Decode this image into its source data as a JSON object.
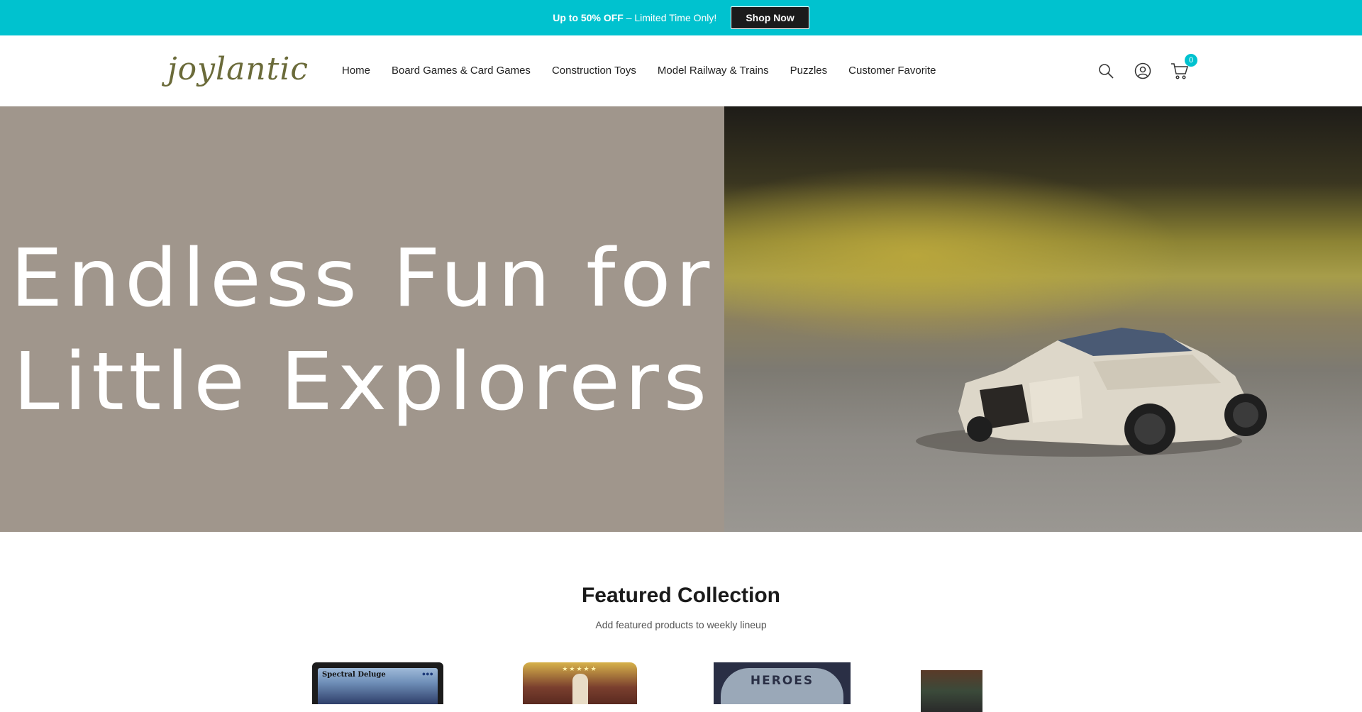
{
  "announcement": {
    "bold_text": "Up to 50% OFF",
    "rest_text": " – Limited Time Only!",
    "button_label": "Shop Now",
    "background_color": "#00c2cf"
  },
  "header": {
    "logo_text": "joylantic",
    "nav": [
      {
        "label": "Home"
      },
      {
        "label": "Board Games & Card Games"
      },
      {
        "label": "Construction Toys"
      },
      {
        "label": "Model Railway & Trains"
      },
      {
        "label": "Puzzles"
      },
      {
        "label": "Customer Favorite"
      }
    ],
    "icons": [
      "search-icon",
      "account-icon",
      "cart-icon"
    ],
    "cart_count": "0"
  },
  "hero": {
    "title_line1": "Endless Fun for",
    "title_line2": "Little Explorers",
    "left_panel_color": "#a0968c",
    "image_subject": "toy brick sports car"
  },
  "featured": {
    "title": "Featured Collection",
    "subtitle": "Add featured products to weekly lineup",
    "products": [
      {
        "card_name": "Spectral Deluge"
      },
      {
        "card_stars": "★★★★★"
      },
      {
        "card_text": "HEROES"
      },
      {}
    ]
  }
}
